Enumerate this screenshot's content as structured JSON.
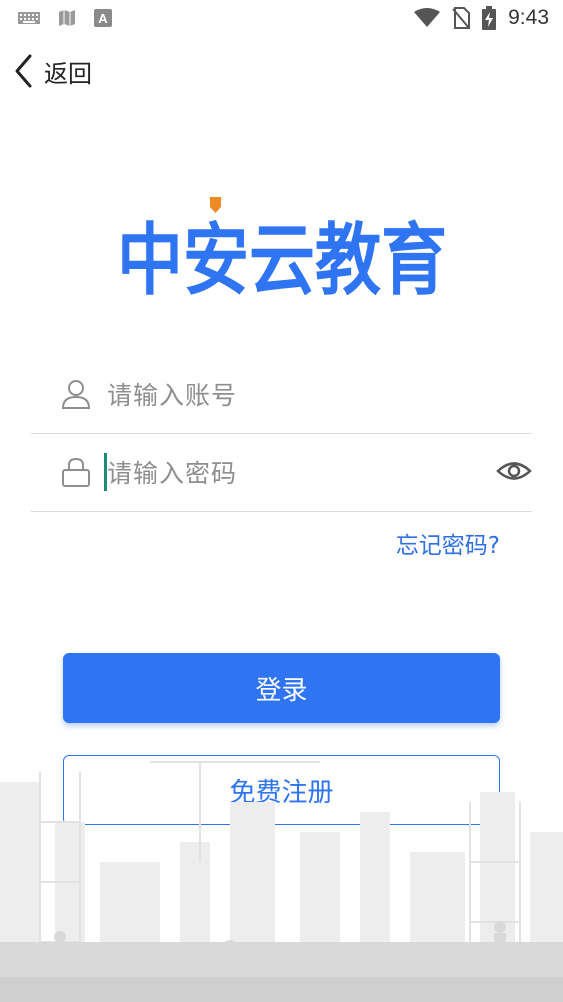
{
  "status_bar": {
    "time": "9:43",
    "icons": [
      "keyboard-icon",
      "map-icon",
      "font-app-icon",
      "wifi-icon",
      "no-sim-icon",
      "battery-charging-icon"
    ]
  },
  "nav": {
    "back_label": "返回",
    "back_icon": "chevron-left-icon"
  },
  "logo": {
    "text": "中安云教育",
    "brand_color": "#2f74f3",
    "accent_color": "#f08a24"
  },
  "account_field": {
    "placeholder": "请输入账号",
    "icon": "user-icon"
  },
  "password_field": {
    "placeholder": "请输入密码",
    "icon": "lock-icon",
    "toggle_icon": "eye-icon"
  },
  "forgot_link": "忘记密码?",
  "login_button": "登录",
  "register_button": "免费注册",
  "colors": {
    "primary": "#2f74f3",
    "caret": "#1e8a78",
    "divider": "#dcdcdc",
    "placeholder": "#8e8e8e"
  }
}
